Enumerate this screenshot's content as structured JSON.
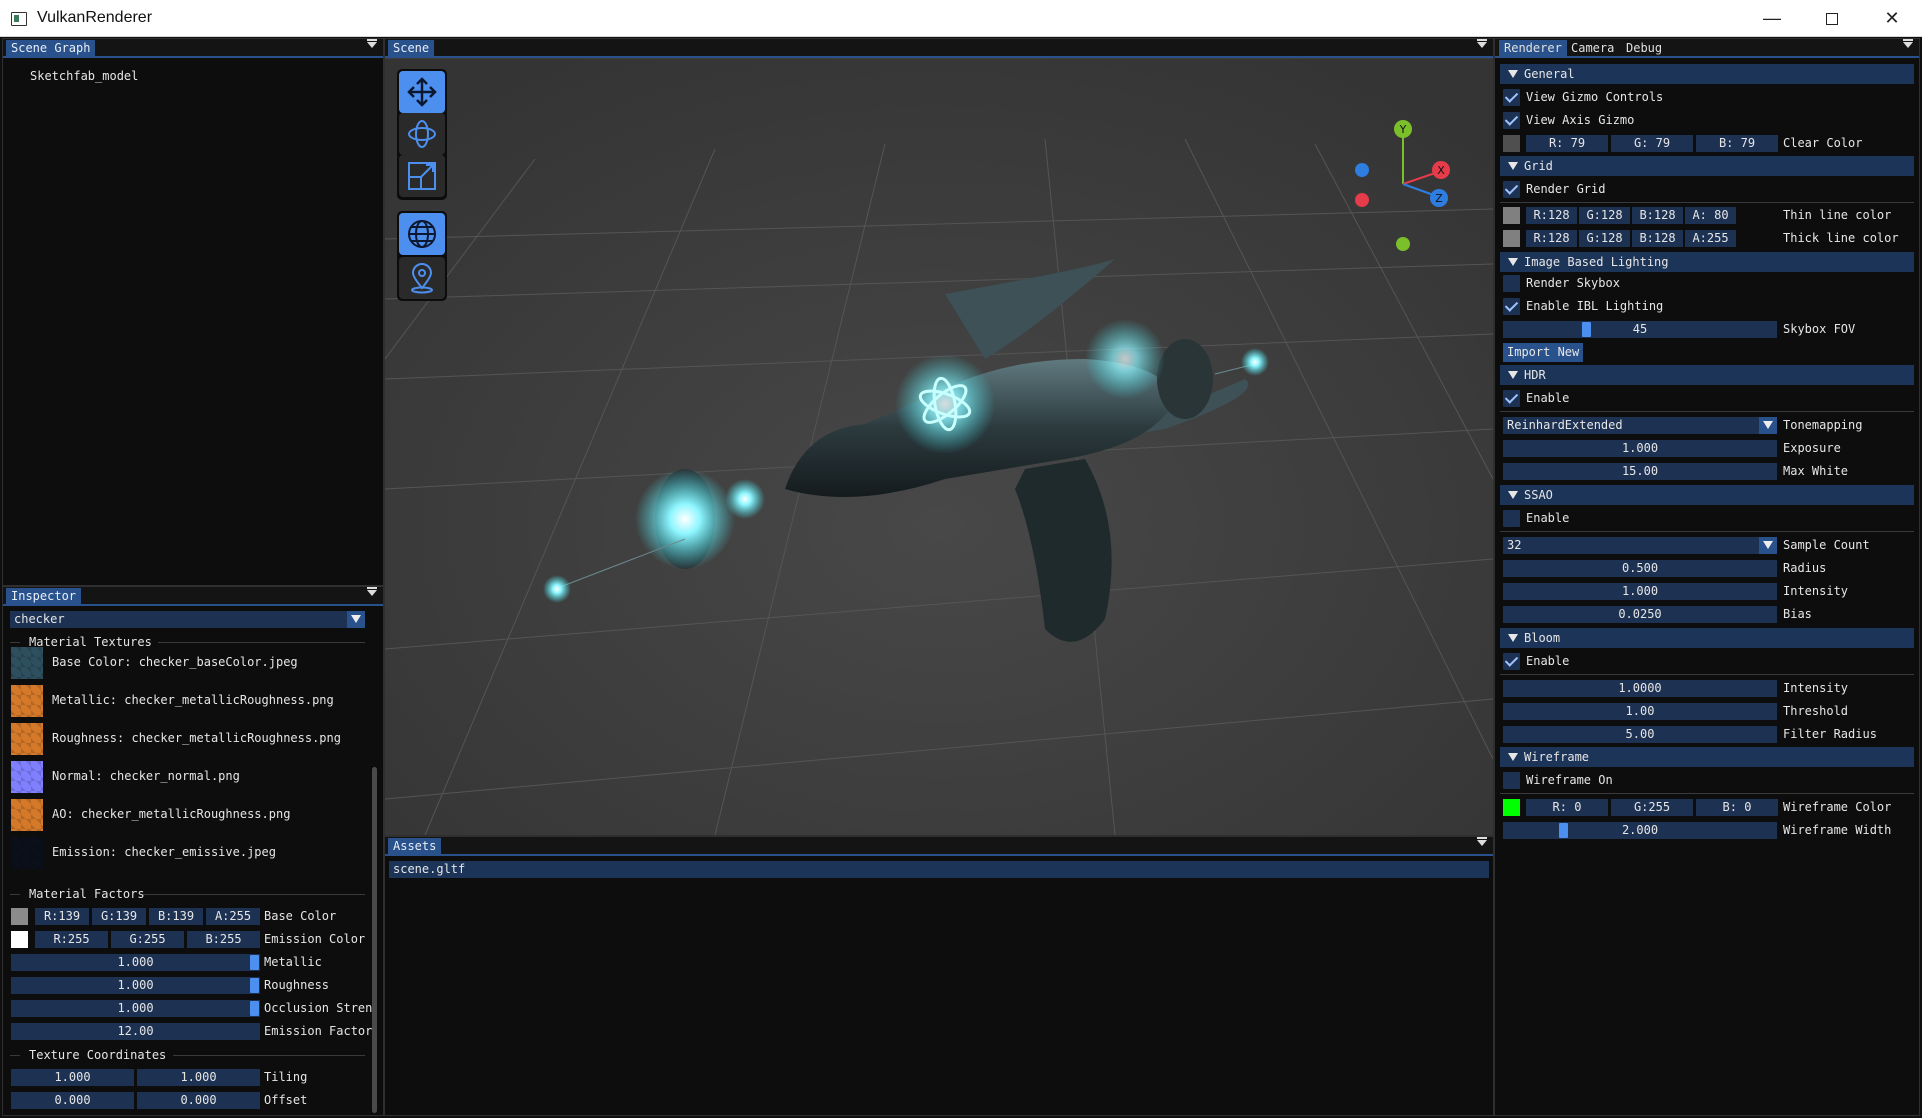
{
  "window": {
    "title": "VulkanRenderer"
  },
  "scene_graph": {
    "tab": "Scene Graph",
    "items": [
      "Sketchfab_model"
    ]
  },
  "scene": {
    "tab": "Scene",
    "colors": {
      "background": "#3d3d3d",
      "glow": "#3fe6f0"
    }
  },
  "gizmo": {
    "y": "Y",
    "x": "X",
    "z": "Z"
  },
  "assets": {
    "tab": "Assets",
    "items": [
      "scene.gltf"
    ]
  },
  "inspector": {
    "tab": "Inspector",
    "material": "checker",
    "textures_header": "Material Textures",
    "textures": [
      {
        "label": "Base Color: checker_baseColor.jpeg",
        "swatch": "#2e4f5e"
      },
      {
        "label": "Metallic: checker_metallicRoughness.png",
        "swatch": "#d4782a"
      },
      {
        "label": "Roughness: checker_metallicRoughness.png",
        "swatch": "#d4782a"
      },
      {
        "label": "Normal: checker_normal.png",
        "swatch": "#8080ff"
      },
      {
        "label": "AO: checker_metallicRoughness.png",
        "swatch": "#d4782a"
      },
      {
        "label": "Emission: checker_emissive.jpeg",
        "swatch": "#0a0f1a"
      }
    ],
    "factors_header": "Material Factors",
    "base_color": {
      "r": "R:139",
      "g": "G:139",
      "b": "B:139",
      "a": "A:255",
      "label": "Base Color",
      "swatch": "#8b8b8b"
    },
    "emission_color": {
      "r": "R:255",
      "g": "G:255",
      "b": "B:255",
      "label": "Emission Color",
      "swatch": "#ffffff"
    },
    "sliders": [
      {
        "value": "1.000",
        "label": "Metallic",
        "level": 1.0
      },
      {
        "value": "1.000",
        "label": "Roughness",
        "level": 1.0
      },
      {
        "value": "1.000",
        "label": "Occlusion Stren",
        "level": 1.0
      }
    ],
    "emission_factor": {
      "value": "12.00",
      "label": "Emission Factor"
    },
    "texcoord_header": "Texture Coordinates",
    "tiling": {
      "u": "1.000",
      "v": "1.000",
      "label": "Tiling"
    },
    "offset": {
      "u": "0.000",
      "v": "0.000",
      "label": "Offset"
    }
  },
  "renderer": {
    "tabs": [
      "Renderer",
      "Camera",
      "Debug"
    ],
    "general": {
      "header": "General",
      "view_gizmo": "View Gizmo Controls",
      "view_axis": "View Axis Gizmo",
      "clear": {
        "r": "R: 79",
        "g": "G: 79",
        "b": "B: 79",
        "label": "Clear Color",
        "swatch": "#4f4f4f"
      }
    },
    "grid": {
      "header": "Grid",
      "render": "Render Grid",
      "thin": {
        "r": "R:128",
        "g": "G:128",
        "b": "B:128",
        "a": "A: 80",
        "label": "Thin line color",
        "swatch": "#808080"
      },
      "thick": {
        "r": "R:128",
        "g": "G:128",
        "b": "B:128",
        "a": "A:255",
        "label": "Thick line color",
        "swatch": "#808080"
      }
    },
    "ibl": {
      "header": "Image Based Lighting",
      "skybox": "Render Skybox",
      "enable": "Enable IBL Lighting",
      "fov": {
        "value": "45",
        "label": "Skybox FOV"
      },
      "import": "Import New"
    },
    "hdr": {
      "header": "HDR",
      "enable": "Enable",
      "tonemap": "ReinhardExtended",
      "tonemap_label": "Tonemapping",
      "exposure": {
        "value": "1.000",
        "label": "Exposure"
      },
      "maxwhite": {
        "value": "15.00",
        "label": "Max White"
      }
    },
    "ssao": {
      "header": "SSAO",
      "enable": "Enable",
      "samples": "32",
      "samples_label": "Sample Count",
      "radius": {
        "value": "0.500",
        "label": "Radius"
      },
      "intensity": {
        "value": "1.000",
        "label": "Intensity"
      },
      "bias": {
        "value": "0.0250",
        "label": "Bias"
      }
    },
    "bloom": {
      "header": "Bloom",
      "enable": "Enable",
      "intensity": {
        "value": "1.0000",
        "label": "Intensity"
      },
      "threshold": {
        "value": "1.00",
        "label": "Threshold"
      },
      "filter": {
        "value": "5.00",
        "label": "Filter Radius"
      }
    },
    "wireframe": {
      "header": "Wireframe",
      "on": "Wireframe On",
      "color": {
        "r": "R: 0",
        "g": "G:255",
        "b": "B: 0",
        "label": "Wireframe Color",
        "swatch": "#00ff00"
      },
      "width": {
        "value": "2.000",
        "label": "Wireframe Width"
      }
    }
  }
}
